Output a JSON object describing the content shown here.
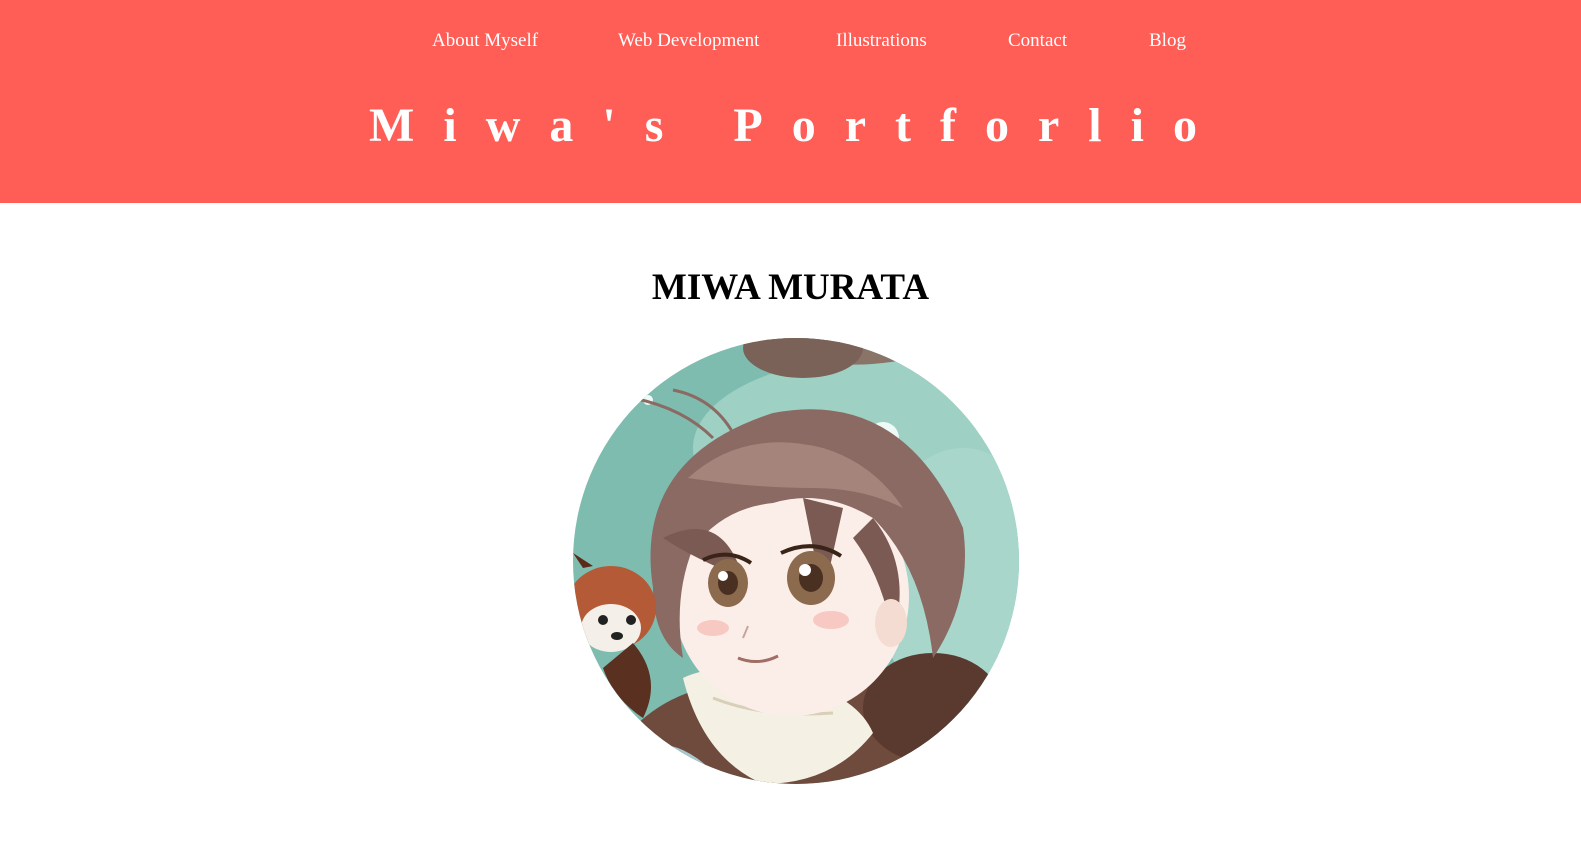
{
  "nav": {
    "items": [
      {
        "label": "About Myself"
      },
      {
        "label": "Web Development"
      },
      {
        "label": "Illustrations"
      },
      {
        "label": "Contact"
      },
      {
        "label": "Blog"
      }
    ]
  },
  "header": {
    "title": "Miwa's Portforlio",
    "background": "#ff5e57",
    "text_color": "#ffffff"
  },
  "profile": {
    "name": "MIWA MURATA",
    "avatar_icon": "anime-portrait-illustration-icon"
  }
}
